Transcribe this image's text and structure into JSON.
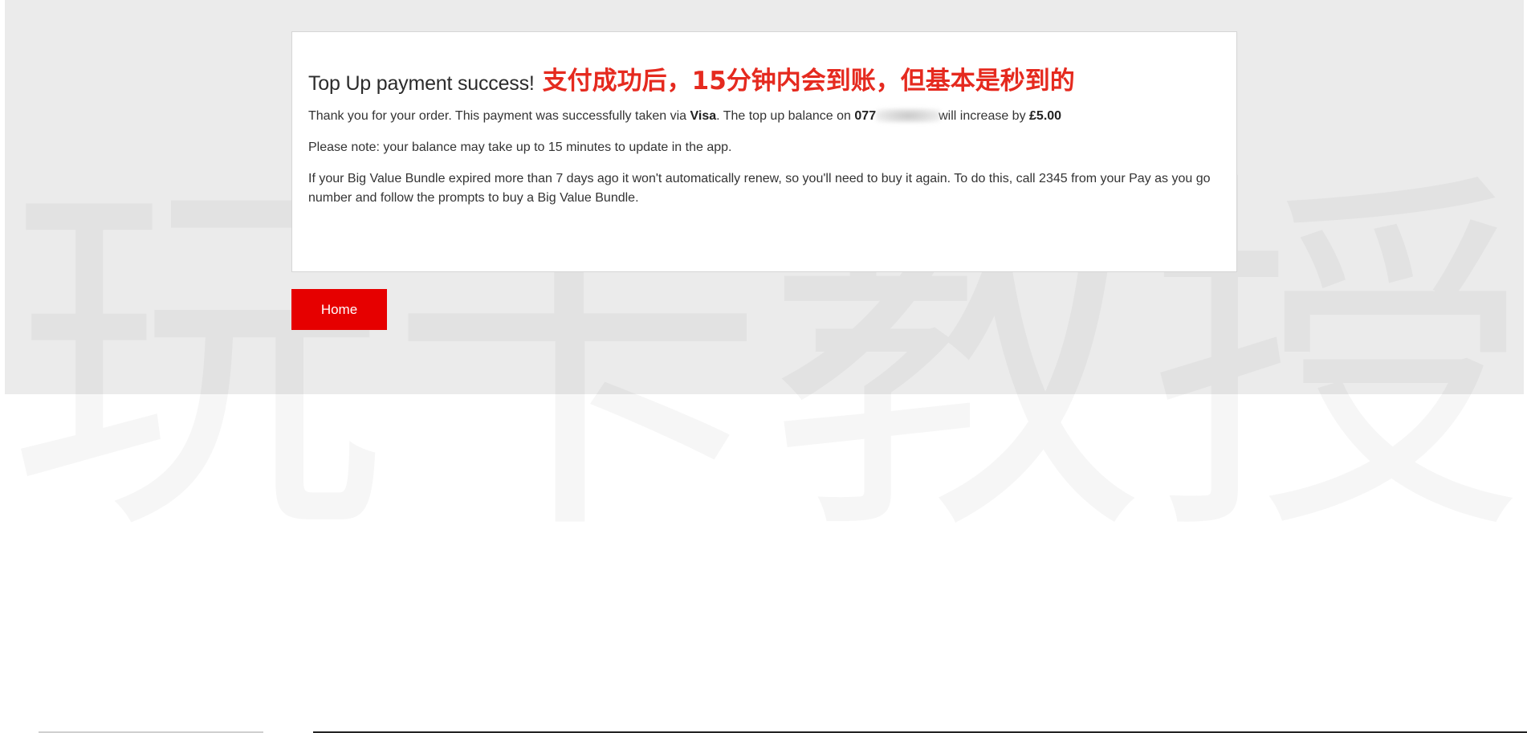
{
  "watermark": {
    "chars": [
      "玩",
      "卡",
      "教",
      "授"
    ]
  },
  "card": {
    "title": "Top Up payment success!",
    "annotation": "支付成功后，15分钟内会到账，但基本是秒到的",
    "paragraph1": {
      "prefix": "Thank you for your order. This payment was successfully taken via ",
      "method": "Visa",
      "middle": ". The top up balance on ",
      "number_visible": "077",
      "number_masked_icon": "blurred-redaction",
      "suffix": "will increase by ",
      "amount": "£5.00"
    },
    "paragraph2": "Please note: your balance may take up to 15 minutes to update in the app.",
    "paragraph3": "If your Big Value Bundle expired more than 7 days ago it won't automatically renew, so you'll need to buy it again. To do this, call 2345 from your Pay as you go number and follow the prompts to buy a Big Value Bundle."
  },
  "actions": {
    "home_label": "Home"
  },
  "colors": {
    "brand_red": "#e60000",
    "annotation_red": "#e52a1f",
    "band_grey": "#ebebeb"
  }
}
